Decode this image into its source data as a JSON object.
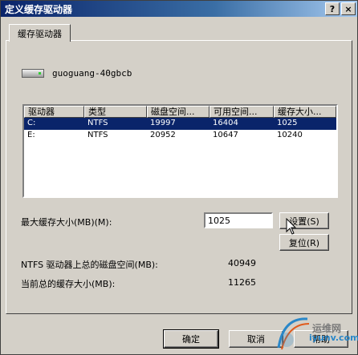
{
  "window": {
    "title": "定义缓存驱动器",
    "help_btn": "?",
    "close_btn": "×"
  },
  "tab": {
    "label": "缓存驱动器"
  },
  "drive": {
    "computer_name": "guoguang-40gbcb"
  },
  "table": {
    "columns": [
      "驱动器",
      "类型",
      "磁盘空间...",
      "可用空间...",
      "缓存大小..."
    ],
    "rows": [
      [
        "C:",
        "NTFS",
        "19997",
        "16404",
        "1025"
      ],
      [
        "E:",
        "NTFS",
        "20952",
        "10647",
        "10240"
      ]
    ],
    "selected_row": 0
  },
  "max_cache": {
    "label": "最大缓存大小(MB)(M):",
    "value": "1025"
  },
  "buttons": {
    "set": "设置(S)",
    "reset": "复位(R)",
    "ok": "确定",
    "cancel": "取消",
    "help": "帮助"
  },
  "summary": {
    "ntfs_total_label": "NTFS 驱动器上总的磁盘空间(MB):",
    "ntfs_total_value": "40949",
    "current_cache_label": "当前总的缓存大小(MB):",
    "current_cache_value": "11265"
  },
  "watermark": {
    "text": "运维网",
    "sub": "iyunv.com"
  },
  "colors": {
    "title_start": "#0a246a",
    "title_end": "#a6caf0",
    "selection": "#0a246a",
    "face": "#d4d0c8"
  }
}
